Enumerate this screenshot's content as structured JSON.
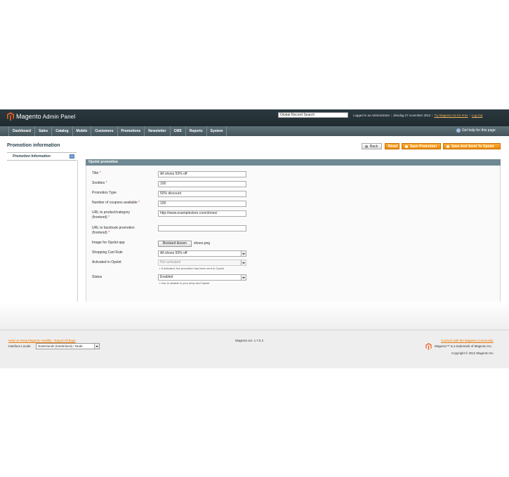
{
  "header": {
    "brand": "Magento",
    "brand_suffix": "Admin Panel",
    "search_value": "Global Record Search",
    "logged_in": "Logged in as Administrator",
    "date": "dinsdag 27 november 2012",
    "try_go": "Try Magento Go for Free",
    "logout": "Log Out"
  },
  "nav": {
    "items": [
      "Dashboard",
      "Sales",
      "Catalog",
      "Mobile",
      "Customers",
      "Promotions",
      "Newsletter",
      "CMS",
      "Reports",
      "System"
    ],
    "help": "Get help for this page"
  },
  "sidebar": {
    "title": "Promotion information",
    "tab": "Promotion Information"
  },
  "actions": {
    "back": "Back",
    "reset": "Reset",
    "save_promotion": "Save Promotion",
    "save_send": "Save And Send To Opslot"
  },
  "form": {
    "section_title": "Opslot promotion",
    "title_label": "Title",
    "title_value": "All shoes 50% off",
    "snotties_label": "Snotties",
    "snotties_value": "100",
    "type_label": "Promotion Type",
    "type_value": "50% discount",
    "coupons_label": "Number of coupons available",
    "coupons_value": "100",
    "url_label_1": "URL to product/category",
    "url_label_2": "(frontend)",
    "url_value": "http://www.examplestore.com/shoes/",
    "fb_label_1": "URL to facebook promotion",
    "fb_label_2": "(frontend)",
    "fb_value": "",
    "image_label": "Image for Opslot app",
    "image_button": "Bestand kiezen",
    "image_file": "shoes.png",
    "rule_label": "Shopping Cart Rule",
    "rule_value": "All shoes 50% off",
    "activated_label": "Activated in Opslot",
    "activated_value": "Not activated",
    "activated_note": "If activated, the promotion has been sent to Opslot",
    "status_label": "Status",
    "status_value": "Enabled",
    "status_note": "Use to disable in your shop and Opslot"
  },
  "footer": {
    "help_links": "Help Us Keep Magento Healthy - Report All Bugs",
    "locale_label": "Interface Locale:",
    "locale_value": "Nederlands (Nederland) / Nede",
    "version": "Magento ver. 1.7.0.2",
    "community": "Connect with the Magento Community",
    "trademark": "Magento™ is a trademark of Magento Inc.",
    "copyright": "Copyright © 2012 Magento Inc."
  },
  "colors": {
    "accent": "#eb8a00",
    "header_bg": "#26343a",
    "nav_bg": "#51626a",
    "section_head": "#6f8992",
    "required": "#eb340a"
  }
}
